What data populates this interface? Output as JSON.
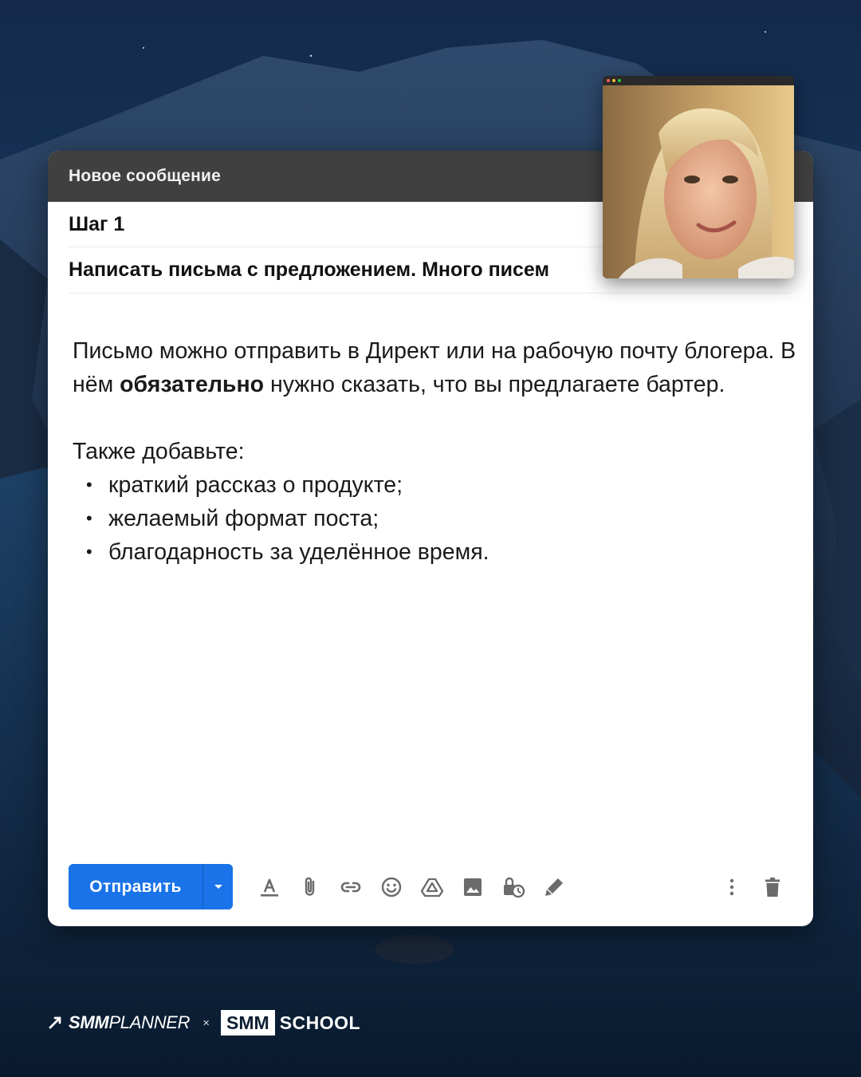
{
  "compose": {
    "header_title": "Новое сообщение",
    "to_value": "Шаг 1",
    "subject_value": "Написать письма с предложением. Много писем",
    "body": {
      "p1_part1": "Письмо можно отправить в Директ или на рабочую почту блогера. В нём ",
      "p1_bold": "обязательно",
      "p1_part2": " нужно сказать, что вы предлагаете бартер.",
      "p2": "Также добавьте:",
      "bullets": [
        "краткий рассказ о продукте;",
        "желаемый формат поста;",
        "благодарность за уделённое время."
      ]
    }
  },
  "toolbar": {
    "send_label": "Отправить",
    "icons": [
      "send-options-chevron-icon",
      "formatting-icon",
      "attach-file-icon",
      "insert-link-icon",
      "emoji-icon",
      "drive-icon",
      "insert-photo-icon",
      "confidential-mode-icon",
      "signature-icon",
      "more-options-icon",
      "discard-draft-icon"
    ],
    "accent_color": "#1a73e8"
  },
  "video_overlay": {
    "window_dots": [
      "#ff5f57",
      "#febc2e",
      "#28c840"
    ]
  },
  "footer": {
    "brand1_bold": "SMM",
    "brand1_light": "PLANNER",
    "separator": "×",
    "brand2_box": "SMM",
    "brand2_text": "SCHOOL"
  },
  "colors": {
    "header_bg": "#404040",
    "background_sky": "#0d1f36"
  }
}
